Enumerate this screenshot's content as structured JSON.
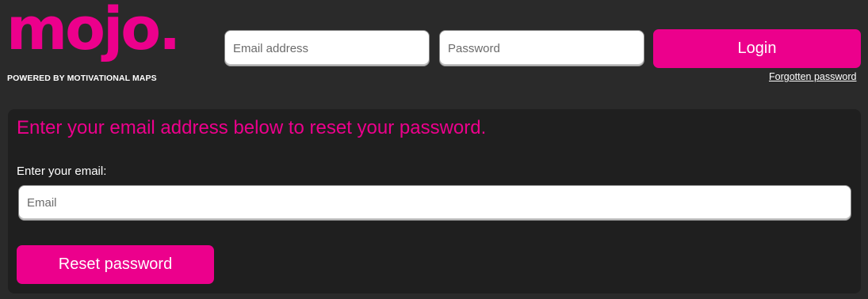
{
  "brand": {
    "logo_text": "mojo.",
    "tagline": "POWERED BY MOTIVATIONAL MAPS",
    "accent_color": "#ec008c"
  },
  "header": {
    "email_placeholder": "Email address",
    "password_placeholder": "Password",
    "login_label": "Login",
    "forgot_label": "Forgotten password"
  },
  "reset": {
    "title": "Enter your email address below to reset your password.",
    "email_label": "Enter your email:",
    "email_placeholder": "Email",
    "button_label": "Reset password"
  }
}
